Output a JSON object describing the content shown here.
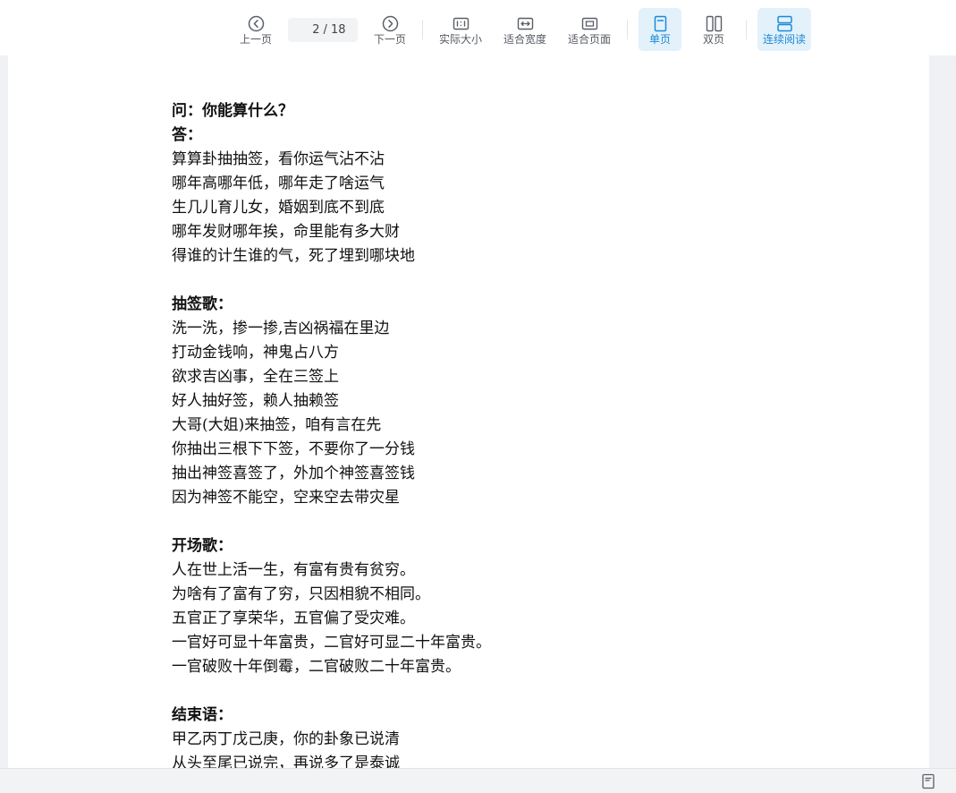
{
  "toolbar": {
    "prev_label": "上一页",
    "current_page": "2",
    "total_pages": "/ 18",
    "next_label": "下一页",
    "actual_size_label": "实际大小",
    "fit_width_label": "适合宽度",
    "fit_page_label": "适合页面",
    "single_page_label": "单页",
    "double_page_label": "双页",
    "continuous_label": "连续阅读",
    "active_color": "#1c8ad6",
    "active_bg": "#e3f1fb"
  },
  "document": {
    "qa_question": "问：你能算什么？",
    "qa_answer": "答：",
    "qa_lines": [
      "算算卦抽抽签，看你运气沾不沾",
      "哪年高哪年低，哪年走了啥运气",
      "生几儿育儿女，婚姻到底不到底",
      "哪年发财哪年挨，命里能有多大财",
      "得谁的计生谁的气，死了埋到哪块地"
    ],
    "song1_title": "抽签歌：",
    "song1_lines": [
      "洗一洗，掺一掺,吉凶祸福在里边",
      "打动金钱响，神鬼占八方",
      "欲求吉凶事，全在三签上",
      "好人抽好签，赖人抽赖签",
      "大哥(大姐)来抽签，咱有言在先",
      "你抽出三根下下签，不要你了一分钱",
      "抽出神签喜签了，外加个神签喜签钱",
      "因为神签不能空，空来空去带灾星"
    ],
    "song2_title": "开场歌：",
    "song2_lines": [
      "人在世上活一生，有富有贵有贫穷。",
      "为啥有了富有了穷，只因相貌不相同。",
      "五官正了享荣华，五官偏了受灾难。",
      "一官好可显十年富贵，二官好可显二十年富贵。",
      "一官破败十年倒霉，二官破败二十年富贵。"
    ],
    "end_title": "结束语：",
    "end_lines": [
      "甲乙丙丁戊己庚，你的卦象已说清",
      "从头至尾已说完，再说多了是泰诚"
    ]
  },
  "footer": {
    "icon": "single-page-icon"
  }
}
